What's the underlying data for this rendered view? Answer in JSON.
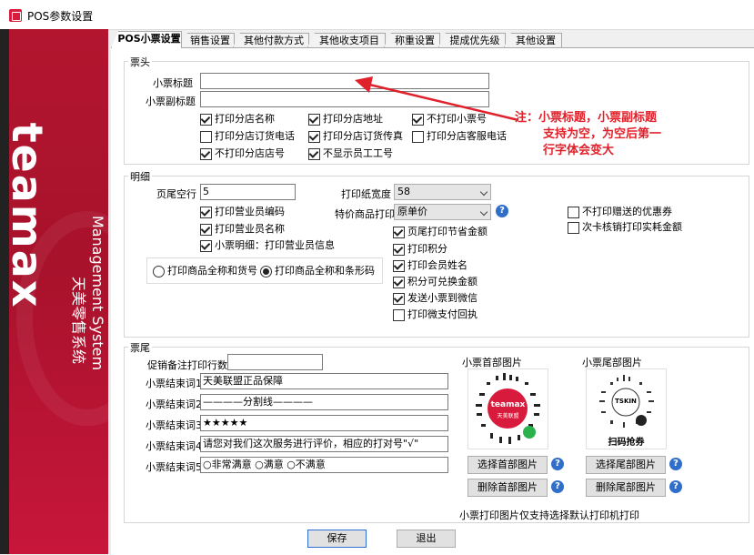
{
  "window": {
    "title": "POS参数设置"
  },
  "banner": {
    "logo": "teamax",
    "subtitle": "Management System",
    "cn": "天美零售系统"
  },
  "tabs": [
    "POS小票设置",
    "销售设置",
    "其他付款方式",
    "其他收支项目",
    "称重设置",
    "提成优先级",
    "其他设置"
  ],
  "header": {
    "legend": "票头",
    "title_label": "小票标题",
    "title_value": "",
    "subtitle_label": "小票副标题",
    "subtitle_value": "",
    "checks": [
      {
        "label": "打印分店名称",
        "checked": true
      },
      {
        "label": "打印分店地址",
        "checked": true
      },
      {
        "label": "不打印小票号",
        "checked": true
      },
      {
        "label": "打印分店订货电话",
        "checked": false
      },
      {
        "label": "打印分店订货传真",
        "checked": true
      },
      {
        "label": "打印分店客服电话",
        "checked": false
      },
      {
        "label": "不打印分店店号",
        "checked": true
      },
      {
        "label": "不显示员工工号",
        "checked": true
      }
    ]
  },
  "annotation": {
    "lines": [
      "注：小票标题，小票副标题",
      "支持为空，为空后第一",
      "行字体会变大"
    ]
  },
  "detail": {
    "legend": "明细",
    "footer_blank_label": "页尾空行",
    "footer_blank_value": "5",
    "paper_width_label": "打印纸宽度",
    "paper_width_value": "58",
    "special_label": "特价商品打印",
    "special_value": "原单价",
    "left_checks": [
      {
        "label": "打印营业员编码",
        "checked": true
      },
      {
        "label": "打印营业员名称",
        "checked": true
      },
      {
        "label": "小票明细：打印营业员信息",
        "checked": true
      }
    ],
    "radios": [
      {
        "label": "打印商品全称和货号",
        "checked": false
      },
      {
        "label": "打印商品全称和条形码",
        "checked": true
      }
    ],
    "mid_checks": [
      {
        "label": "页尾打印节省金额",
        "checked": true
      },
      {
        "label": "打印积分",
        "checked": true
      },
      {
        "label": "打印会员姓名",
        "checked": true
      },
      {
        "label": "积分可兑换金额",
        "checked": true
      },
      {
        "label": "发送小票到微信",
        "checked": true
      },
      {
        "label": "打印微支付回执",
        "checked": false
      }
    ],
    "right_checks": [
      {
        "label": "不打印赠送的优惠券",
        "checked": false
      },
      {
        "label": "次卡核销打印实耗金额",
        "checked": false
      }
    ]
  },
  "footer": {
    "legend": "票尾",
    "promo_label": "促销备注打印行数",
    "promo_value": "",
    "end_lines": [
      {
        "label": "小票结束词1",
        "value": "天美联盟正品保障"
      },
      {
        "label": "小票结束词2",
        "value": "————分割线————"
      },
      {
        "label": "小票结束词3",
        "value": "★★★★★"
      },
      {
        "label": "小票结束词4",
        "value": "请您对我们这次服务进行评价，相应的打对号\"√\""
      },
      {
        "label": "小票结束词5",
        "value": "○非常满意  ○满意  ○不满意"
      }
    ],
    "head_image_label": "小票首部图片",
    "tail_image_label": "小票尾部图片",
    "head_qr_text": "teamax",
    "head_qr_sub": "天美联盟",
    "tail_qr_text": "TSKIN",
    "tail_qr_caption": "扫码抢券",
    "select_head": "选择首部图片",
    "delete_head": "删除首部图片",
    "select_tail": "选择尾部图片",
    "delete_tail": "删除尾部图片",
    "image_note": "小票打印图片仅支持选择默认打印机打印"
  },
  "buttons": {
    "save": "保存",
    "exit": "退出"
  },
  "colors": {
    "brand": "#b3152f",
    "note": "#e0202a",
    "help": "#2f6fca"
  }
}
